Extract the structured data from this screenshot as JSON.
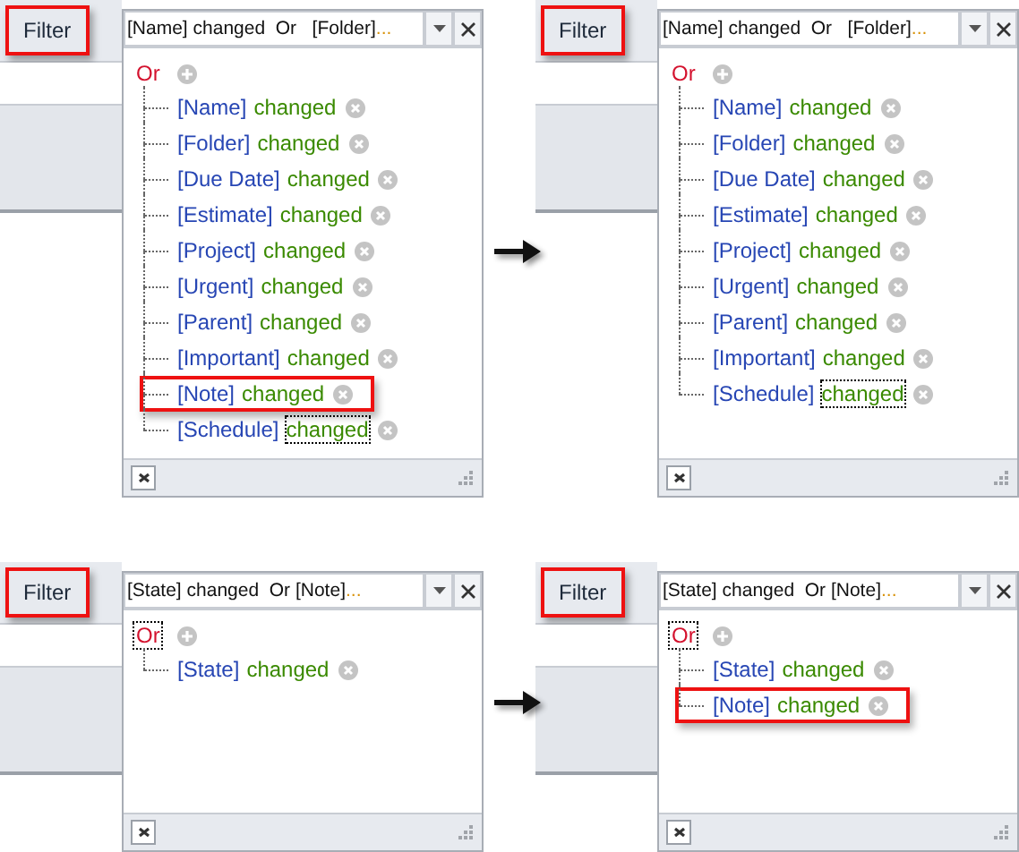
{
  "panels": [
    {
      "filter_tab": {
        "label": "Filter",
        "highlighted": true
      },
      "combo": {
        "text": "[Name] changed  Or   [Folder]",
        "ellipsis": "..."
      },
      "root": {
        "label": "Or",
        "focused": false
      },
      "conditions": [
        {
          "field": "[Name]",
          "op": "changed",
          "highlighted": false,
          "focused": false
        },
        {
          "field": "[Folder]",
          "op": "changed",
          "highlighted": false,
          "focused": false
        },
        {
          "field": "[Due Date]",
          "op": "changed",
          "highlighted": false,
          "focused": false
        },
        {
          "field": "[Estimate]",
          "op": "changed",
          "highlighted": false,
          "focused": false
        },
        {
          "field": "[Project]",
          "op": "changed",
          "highlighted": false,
          "focused": false
        },
        {
          "field": "[Urgent]",
          "op": "changed",
          "highlighted": false,
          "focused": false
        },
        {
          "field": "[Parent]",
          "op": "changed",
          "highlighted": false,
          "focused": false
        },
        {
          "field": "[Important]",
          "op": "changed",
          "highlighted": false,
          "focused": false
        },
        {
          "field": "[Note]",
          "op": "changed",
          "highlighted": true,
          "focused": false
        },
        {
          "field": "[Schedule]",
          "op": "changed",
          "highlighted": false,
          "focused": true
        }
      ]
    },
    {
      "filter_tab": {
        "label": "Filter",
        "highlighted": true
      },
      "combo": {
        "text": "[Name] changed  Or   [Folder]",
        "ellipsis": "..."
      },
      "root": {
        "label": "Or",
        "focused": false
      },
      "conditions": [
        {
          "field": "[Name]",
          "op": "changed",
          "highlighted": false,
          "focused": false
        },
        {
          "field": "[Folder]",
          "op": "changed",
          "highlighted": false,
          "focused": false
        },
        {
          "field": "[Due Date]",
          "op": "changed",
          "highlighted": false,
          "focused": false
        },
        {
          "field": "[Estimate]",
          "op": "changed",
          "highlighted": false,
          "focused": false
        },
        {
          "field": "[Project]",
          "op": "changed",
          "highlighted": false,
          "focused": false
        },
        {
          "field": "[Urgent]",
          "op": "changed",
          "highlighted": false,
          "focused": false
        },
        {
          "field": "[Parent]",
          "op": "changed",
          "highlighted": false,
          "focused": false
        },
        {
          "field": "[Important]",
          "op": "changed",
          "highlighted": false,
          "focused": false
        },
        {
          "field": "[Schedule]",
          "op": "changed",
          "highlighted": false,
          "focused": true
        }
      ]
    },
    {
      "filter_tab": {
        "label": "Filter",
        "highlighted": true
      },
      "combo": {
        "text": "[State] changed  Or [Note]",
        "ellipsis": "..."
      },
      "root": {
        "label": "Or",
        "focused": true
      },
      "conditions": [
        {
          "field": "[State]",
          "op": "changed",
          "highlighted": false,
          "focused": false
        }
      ]
    },
    {
      "filter_tab": {
        "label": "Filter",
        "highlighted": true
      },
      "combo": {
        "text": "[State] changed  Or [Note]",
        "ellipsis": "..."
      },
      "root": {
        "label": "Or",
        "focused": true
      },
      "conditions": [
        {
          "field": "[State]",
          "op": "changed",
          "highlighted": false,
          "focused": false
        },
        {
          "field": "[Note]",
          "op": "changed",
          "highlighted": true,
          "focused": false
        }
      ]
    }
  ]
}
